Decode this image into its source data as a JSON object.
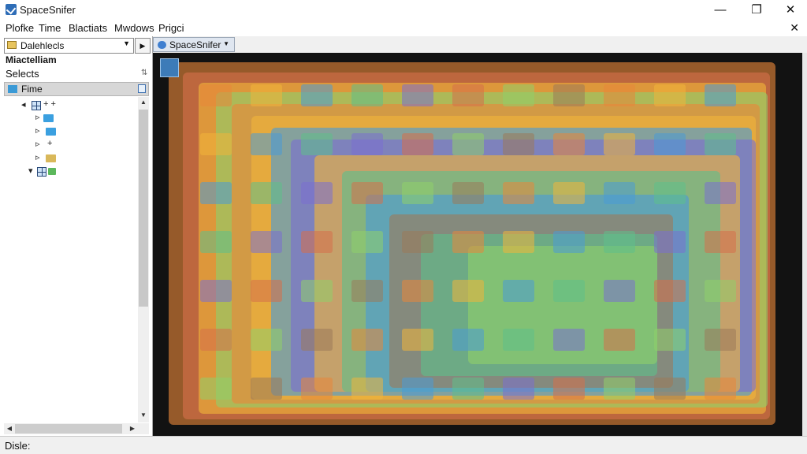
{
  "window": {
    "title": "SpaceSnifer",
    "minimize_glyph": "—",
    "maximize_glyph": "❐",
    "close_glyph": "✕"
  },
  "menu": {
    "items": [
      "Plofke",
      "Time",
      "Blactiats",
      "Mwdows",
      "Prigci"
    ],
    "close_glyph": "✕"
  },
  "left_panel": {
    "drive_combo_label": "Dalehlecls",
    "heading": "Miactelliam",
    "subheading": "Selects",
    "pin_glyph": "⇅",
    "tree_header_label": "Fime",
    "tree": [
      {
        "icon": "grid-icon",
        "label": "+ +",
        "expander": "◂"
      },
      {
        "icon": "folder-icon",
        "label": "",
        "expander": "▹"
      },
      {
        "icon": "folder-icon",
        "label": "",
        "expander": "▹"
      },
      {
        "icon": "folder-icon",
        "label": "+",
        "expander": "▹"
      },
      {
        "icon": "folder-icon",
        "label": "",
        "expander": "▹"
      },
      {
        "icon": "grid-icon",
        "label": "",
        "expander": "▾"
      }
    ]
  },
  "tab": {
    "label": "SpaceSnifer"
  },
  "status": {
    "text": "Disle:"
  },
  "colors": {
    "map_background": "#121212",
    "accent": "#2e6db7",
    "block_palette": [
      "#e8873a",
      "#f0b43a",
      "#4b9bd6",
      "#5fbf8a",
      "#7a6fd0",
      "#d5704a",
      "#8fcf6a",
      "#9b7a5a"
    ]
  }
}
